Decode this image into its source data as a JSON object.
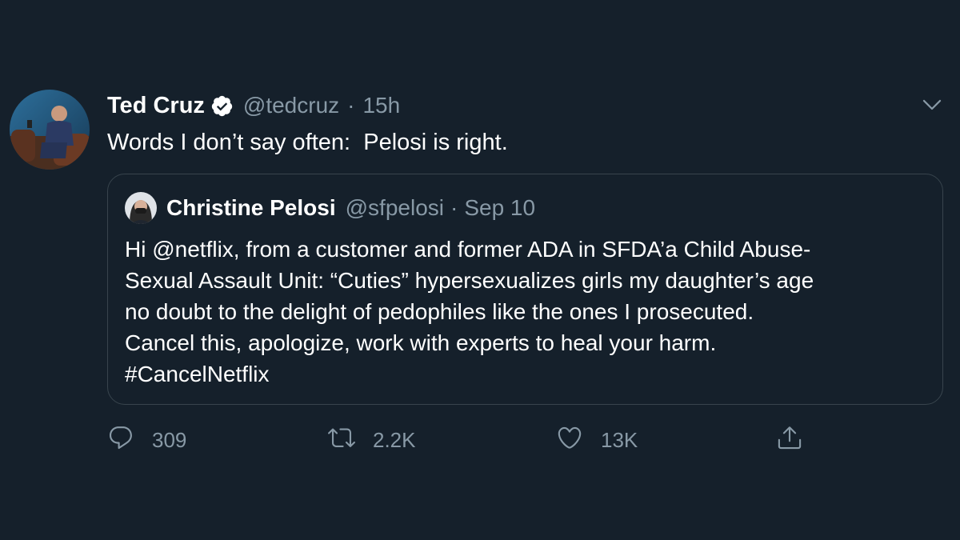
{
  "tweet": {
    "author_name": "Ted Cruz",
    "handle": "@tedcruz",
    "separator": "·",
    "time": "15h",
    "text": "Words I don’t say often:  Pelosi is right."
  },
  "quoted_tweet": {
    "author_name": "Christine Pelosi",
    "handle": "@sfpelosi",
    "separator": "·",
    "time": "Sep 10",
    "lines": [
      "Hi @netflix, from a customer and former ADA in SFDA’a Child Abuse-",
      "Sexual Assault Unit: “Cuties” hypersexualizes girls my daughter’s age",
      "no doubt to the delight of pedophiles like the ones I prosecuted.",
      "Cancel this, apologize, work with experts to heal your harm.",
      "#CancelNetflix"
    ]
  },
  "actions": {
    "reply_count": "309",
    "retweet_count": "2.2K",
    "like_count": "13K"
  },
  "icons": {
    "verified": "verified-badge-icon",
    "menu": "chevron-down-icon",
    "reply": "reply-icon",
    "retweet": "retweet-icon",
    "like": "heart-icon",
    "share": "share-icon"
  },
  "colors": {
    "background": "#15202b",
    "secondary_text": "#8899a6",
    "border": "#38444d",
    "primary_text": "#ffffff"
  }
}
